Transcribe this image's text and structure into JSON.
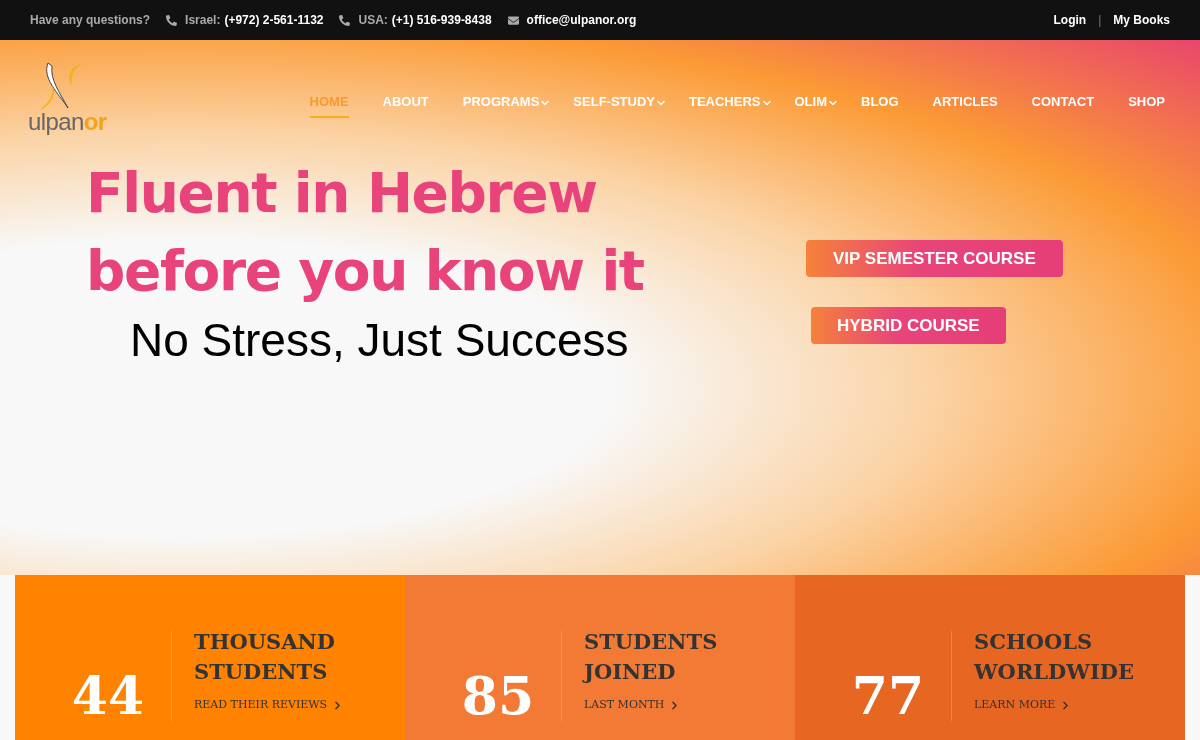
{
  "topbar": {
    "question": "Have any questions?",
    "contacts": [
      {
        "kind": "phone",
        "label": "Israel:",
        "value": "(+972) 2-561-1132"
      },
      {
        "kind": "phone",
        "label": "USA:",
        "value": "(+1) 516-939-8438"
      },
      {
        "kind": "email",
        "value": "office@ulpanor.org"
      }
    ],
    "links": [
      "Login",
      "My Books"
    ],
    "separator": "|"
  },
  "logo": {
    "main": "ulpan",
    "accent": "or"
  },
  "nav": [
    {
      "label": "HOME",
      "selected": true,
      "dropdown": false
    },
    {
      "label": "ABOUT",
      "selected": false,
      "dropdown": false
    },
    {
      "label": "PROGRAMS",
      "selected": false,
      "dropdown": true
    },
    {
      "label": "SELF-STUDY",
      "selected": false,
      "dropdown": true
    },
    {
      "label": "TEACHERS",
      "selected": false,
      "dropdown": true
    },
    {
      "label": "OLIM",
      "selected": false,
      "dropdown": true
    },
    {
      "label": "BLOG",
      "selected": false,
      "dropdown": false
    },
    {
      "label": "ARTICLES",
      "selected": false,
      "dropdown": false
    },
    {
      "label": "CONTACT",
      "selected": false,
      "dropdown": false
    },
    {
      "label": "SHOP",
      "selected": false,
      "dropdown": false
    }
  ],
  "hero": {
    "headline": [
      "Fluent in Hebrew",
      "before you know it"
    ],
    "tagline": "No Stress, Just Success",
    "buttons": [
      "VIP SEMESTER COURSE",
      "HYBRID COURSE"
    ]
  },
  "stats": [
    {
      "number": "44",
      "title": [
        "THOUSAND",
        "STUDENTS"
      ],
      "link": "READ THEIR REVIEWS",
      "color": "#ff8200"
    },
    {
      "number": "85",
      "title": [
        "STUDENTS",
        "JOINED"
      ],
      "link": "LAST MONTH",
      "color": "#f27a35"
    },
    {
      "number": "77",
      "title": [
        "SCHOOLS",
        "WORLDWIDE"
      ],
      "link": "LEARN MORE",
      "color": "#e66622"
    }
  ]
}
